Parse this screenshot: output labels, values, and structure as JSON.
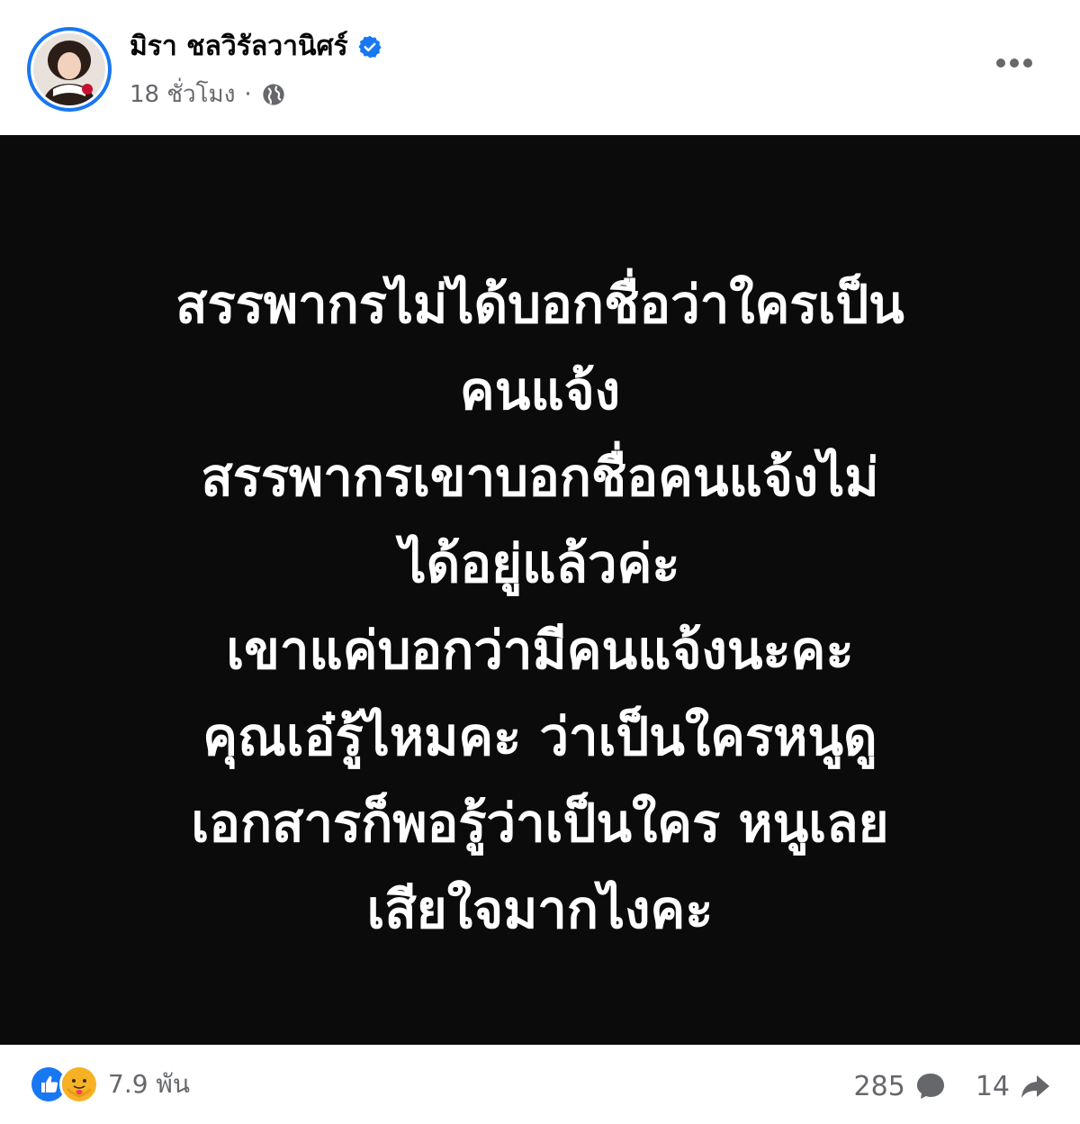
{
  "header": {
    "author_name": "มิรา ชลวิรัลวานิศร์",
    "timestamp": "18 ชั่วโมง",
    "separator": "·",
    "verified_icon": "verified-badge-icon",
    "privacy_icon": "globe-icon",
    "more_icon": "more-options-icon"
  },
  "post": {
    "background_color": "#0b0b0b",
    "text_color": "#ffffff",
    "lines": [
      "สรรพากรไม่ได้บอกชื่อว่าใครเป็น",
      "คนแจ้ง",
      "สรรพากรเขาบอกชื่อคนแจ้งไม่",
      "ได้อยู่แล้วค่ะ",
      "เขาแค่บอกว่ามีคนแจ้งนะคะ",
      "คุณเอ๋รู้ไหมคะ ว่าเป็นใครหนูดู",
      "เอกสารก็พอรู้ว่าเป็นใคร หนูเลย",
      "เสียใจมากไงคะ"
    ]
  },
  "footer": {
    "reaction_count": "7.9 พัน",
    "reaction_icons": [
      "like-icon",
      "care-icon"
    ],
    "comment_count": "285",
    "comment_icon": "comment-icon",
    "share_count": "14",
    "share_icon": "share-icon"
  },
  "colors": {
    "accent": "#1877f2",
    "muted_text": "#65676b",
    "care_yellow": "#f7b125"
  }
}
